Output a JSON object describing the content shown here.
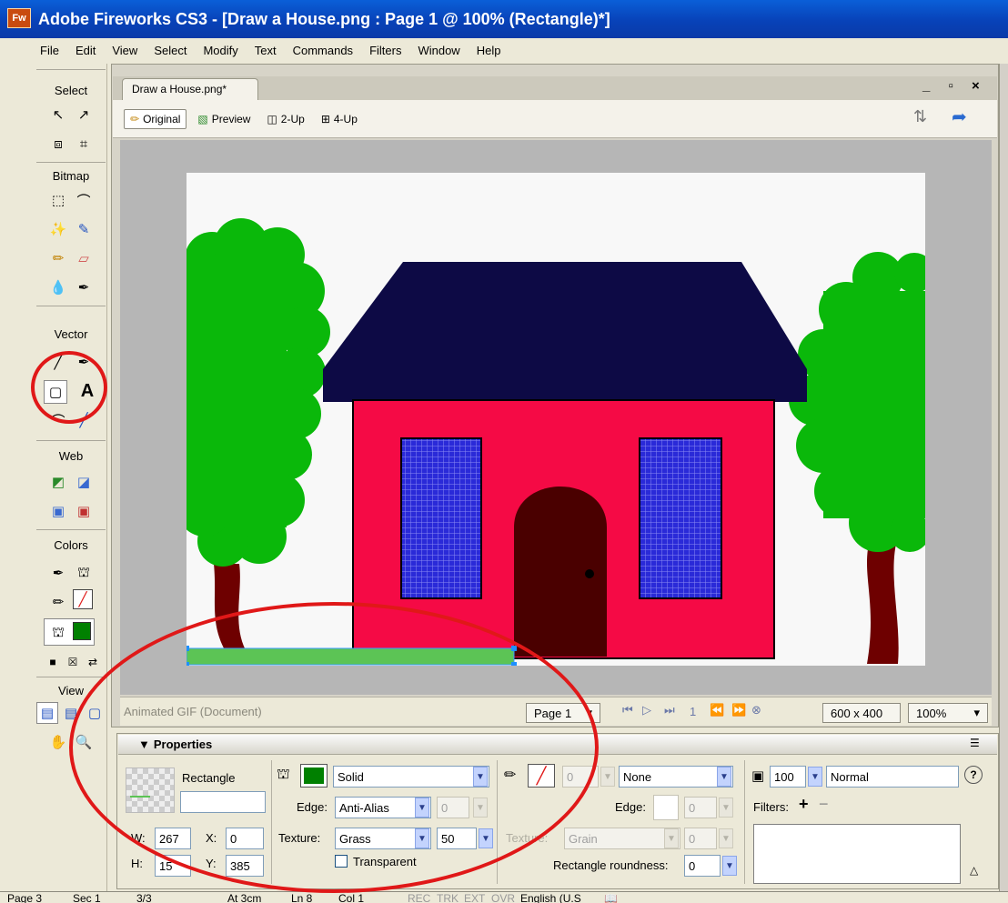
{
  "window": {
    "title": "Adobe Fireworks CS3 - [Draw a House.png : Page 1 @ 100% (Rectangle)*]",
    "app_icon_text": "Fw"
  },
  "menu": [
    "File",
    "Edit",
    "View",
    "Select",
    "Modify",
    "Text",
    "Commands",
    "Filters",
    "Window",
    "Help"
  ],
  "tools": {
    "sections": [
      "Select",
      "Bitmap",
      "Vector",
      "Web",
      "Colors",
      "View"
    ]
  },
  "document": {
    "tab_label": "Draw a House.png*",
    "window_controls": "_ ▫ ×",
    "views": [
      "Original",
      "Preview",
      "2-Up",
      "4-Up"
    ],
    "status": {
      "doc_type": "Animated GIF (Document)",
      "page": "Page 1",
      "frame": "1",
      "size": "600 x 400",
      "zoom": "100%"
    }
  },
  "properties": {
    "title": "Properties",
    "object_type": "Rectangle",
    "object_name": "",
    "w_label": "W:",
    "w": "267",
    "h_label": "H:",
    "h": "15",
    "x_label": "X:",
    "x": "0",
    "y_label": "Y:",
    "y": "385",
    "fill_type": "Solid",
    "edge_label": "Edge:",
    "edge": "Anti-Alias",
    "edge_feather": "0",
    "texture_label": "Texture:",
    "texture": "Grass",
    "texture_amount": "50",
    "transparent_label": "Transparent",
    "stroke_size": "0",
    "stroke_type": "None",
    "stroke_edge_label": "Edge:",
    "stroke_edge": "0",
    "stroke_texture_label": "Texture:",
    "stroke_texture": "Grain",
    "stroke_texture_amount": "0",
    "roundness_label": "Rectangle roundness:",
    "roundness": "0",
    "opacity": "100",
    "blend_mode": "Normal",
    "filters_label": "Filters:",
    "fill_color": "#008000",
    "help_icon": "?"
  },
  "statusbar": {
    "page": "Page 3",
    "sec": "Sec 1",
    "pages": "3/3",
    "at": "At 3cm",
    "ln": "Ln 8",
    "col": "Col 1",
    "rec": "REC",
    "trk": "TRK",
    "ext": "EXT",
    "ovr": "OVR",
    "language": "English (U.S"
  },
  "colors": {
    "roof": "#0d0a45",
    "house": "#f50a45",
    "door": "#4a0000",
    "window": "#2a2ad8",
    "tree": "#0ab80a",
    "trunk": "#6e0000",
    "grass": "#5cc455",
    "annotation": "#e01818"
  }
}
